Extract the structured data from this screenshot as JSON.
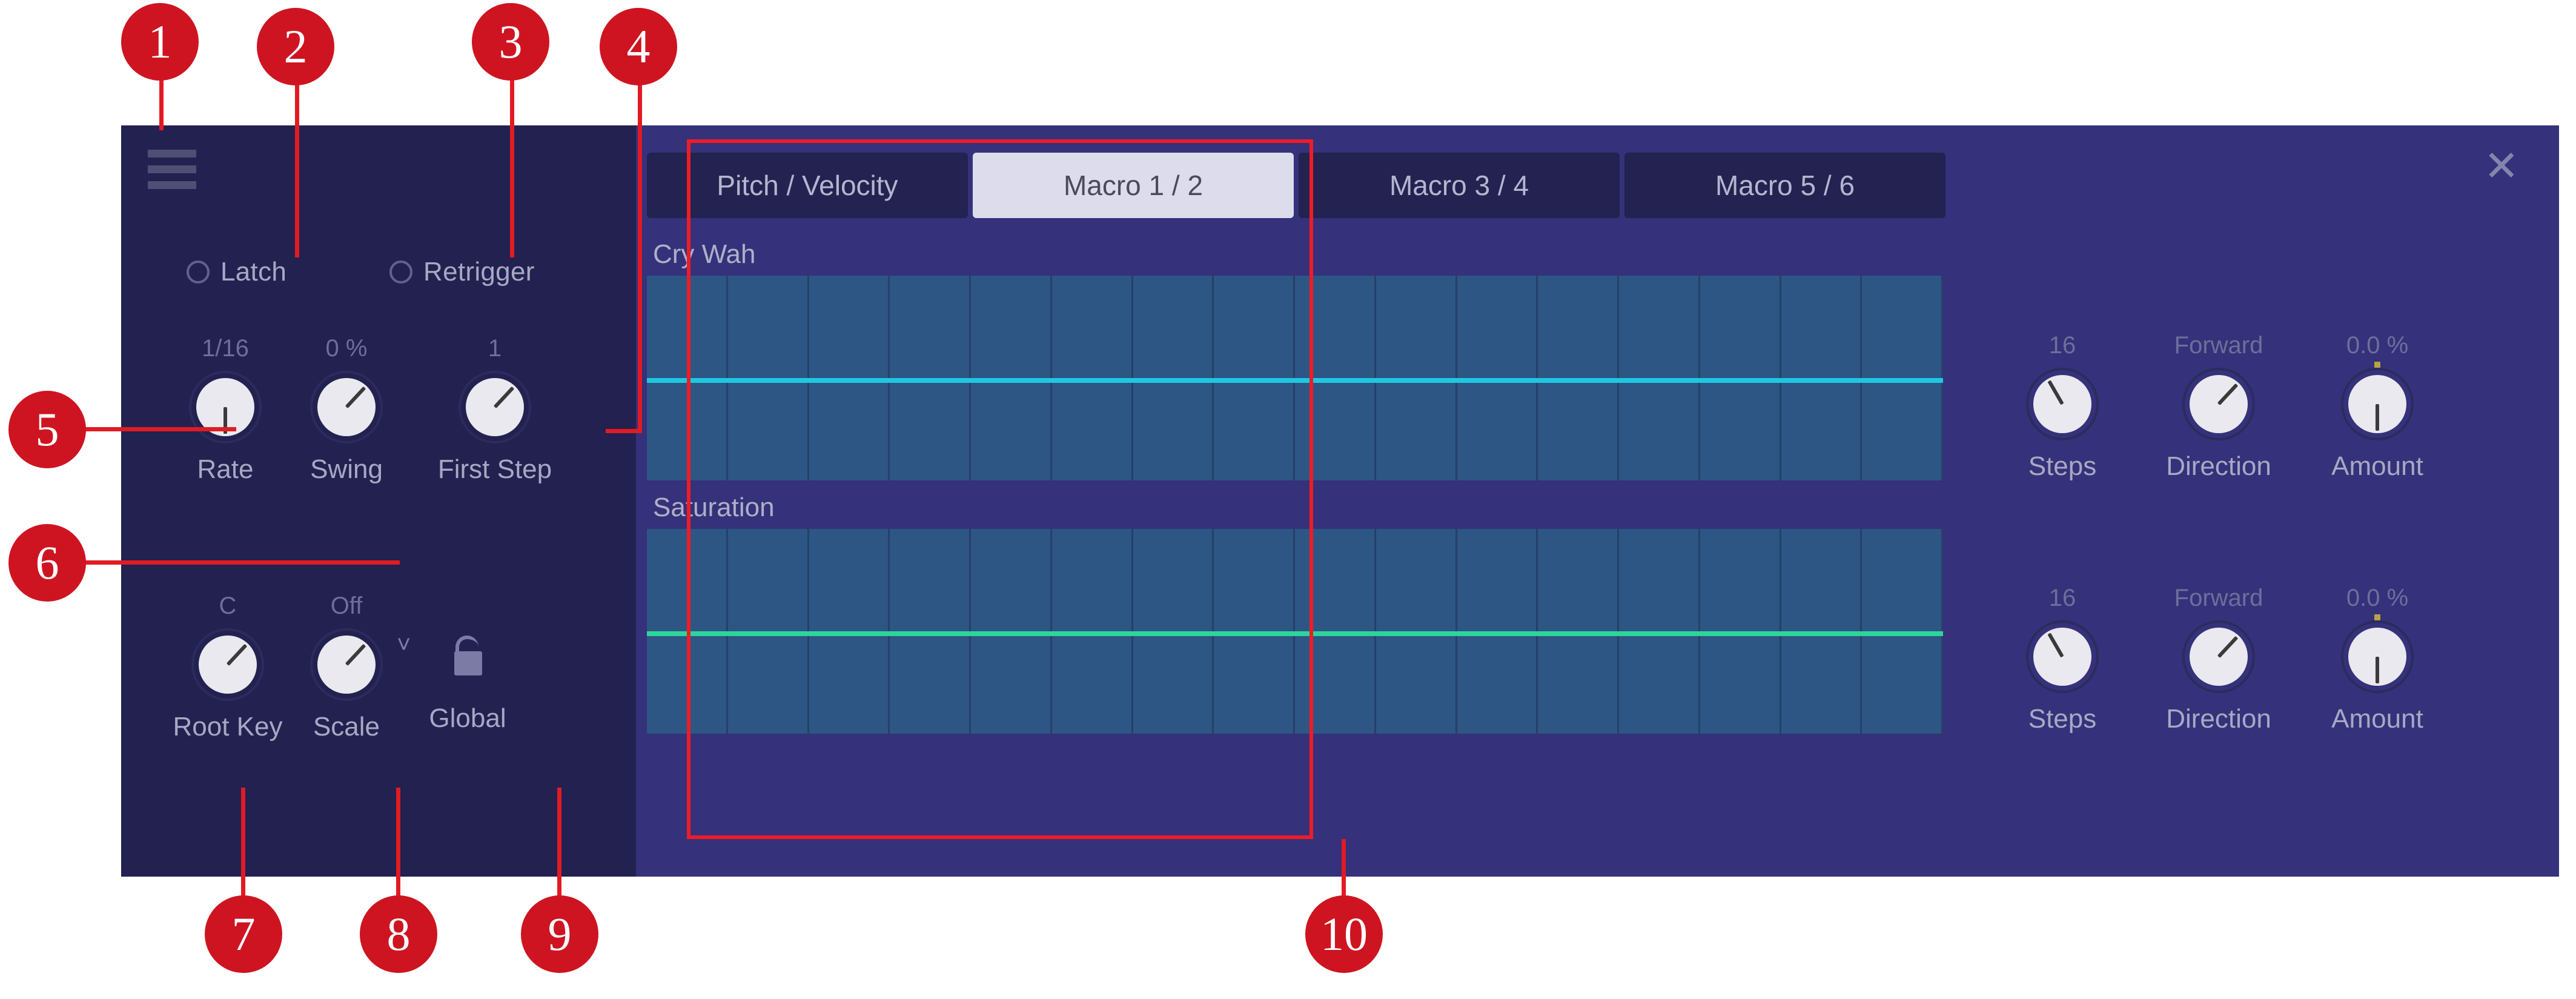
{
  "colors": {
    "panel_bg": "#35317a",
    "sidebar_bg": "#222150",
    "tab_active_bg": "#dcdcec",
    "tab_inactive_bg": "#232250",
    "grid_bg": "#2d5684",
    "callout_red": "#ce1421",
    "highlight_red": "#ee1c26",
    "lane1_line": "#1ec8e0",
    "lane2_line": "#2fd49a",
    "knob_face": "#e9e9ef",
    "label_text": "#a9a8c4",
    "value_text": "#6f6e9b"
  },
  "sidebar": {
    "menu_icon": "hamburger-icon",
    "toggles": [
      {
        "label": "Latch",
        "checked": false
      },
      {
        "label": "Retrigger",
        "checked": false
      }
    ],
    "knobs_row1": [
      {
        "label": "Rate",
        "value": "1/16",
        "angle": 0
      },
      {
        "label": "Swing",
        "value": "0 %",
        "angle": -137
      },
      {
        "label": "First Step",
        "value": "1",
        "angle": -137
      }
    ],
    "knobs_row2": [
      {
        "label": "Root Key",
        "value": "C",
        "angle": -137
      },
      {
        "label": "Scale",
        "value": "Off",
        "angle": -137
      }
    ],
    "scale_dropdown_icon": "chevron-down-icon",
    "global": {
      "label": "Global",
      "icon": "unlocked-padlock-icon",
      "locked": false
    }
  },
  "main": {
    "close_icon": "close-icon",
    "tabs": [
      {
        "label": "Pitch / Velocity",
        "active": false
      },
      {
        "label": "Macro 1 / 2",
        "active": true
      },
      {
        "label": "Macro 3 / 4",
        "active": false
      },
      {
        "label": "Macro 5 / 6",
        "active": false
      }
    ],
    "lanes": [
      {
        "title": "Cry Wah",
        "steps": 16,
        "line_color": "#1ec8e0",
        "line_position_pct": 50
      },
      {
        "title": "Saturation",
        "steps": 16,
        "line_color": "#2fd49a",
        "line_position_pct": 50
      }
    ],
    "right_controls": [
      {
        "knobs": [
          {
            "label": "Steps",
            "value": "16",
            "angle": 150
          },
          {
            "label": "Direction",
            "value": "Forward",
            "angle": -137
          },
          {
            "label": "Amount",
            "value": "0.0 %",
            "angle": 0,
            "marker": true
          }
        ]
      },
      {
        "knobs": [
          {
            "label": "Steps",
            "value": "16",
            "angle": 150
          },
          {
            "label": "Direction",
            "value": "Forward",
            "angle": -137
          },
          {
            "label": "Amount",
            "value": "0.0 %",
            "angle": 0,
            "marker": true
          }
        ]
      }
    ]
  },
  "callouts": [
    {
      "n": "1"
    },
    {
      "n": "2"
    },
    {
      "n": "3"
    },
    {
      "n": "4"
    },
    {
      "n": "5"
    },
    {
      "n": "6"
    },
    {
      "n": "7"
    },
    {
      "n": "8"
    },
    {
      "n": "9"
    },
    {
      "n": "10"
    }
  ]
}
